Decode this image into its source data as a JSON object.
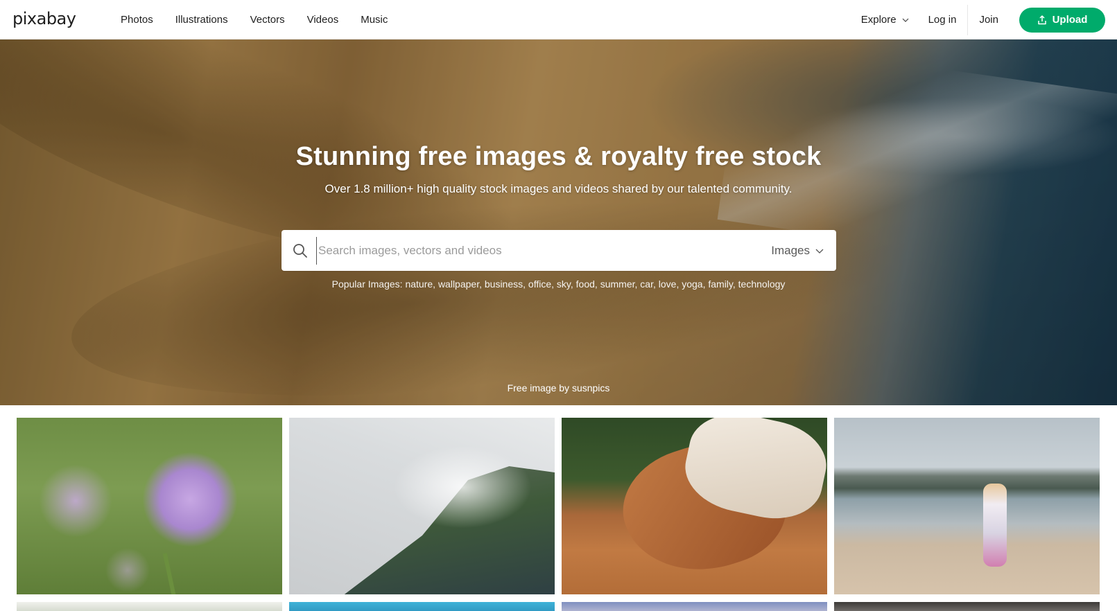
{
  "header": {
    "logo_text": "pixabay",
    "nav": [
      "Photos",
      "Illustrations",
      "Vectors",
      "Videos",
      "Music"
    ],
    "explore_label": "Explore",
    "login_label": "Log in",
    "join_label": "Join",
    "upload_label": "Upload",
    "accent_color": "#00ab6b"
  },
  "hero": {
    "title": "Stunning free images & royalty free stock",
    "subtitle": "Over 1.8 million+ high quality stock images and videos shared by our talented community.",
    "search": {
      "placeholder": "Search images, vectors and videos",
      "value": "",
      "type_selected": "Images"
    },
    "popular_label": "Popular Images:",
    "popular_tags": [
      "nature",
      "wallpaper",
      "business",
      "office",
      "sky",
      "food",
      "summer",
      "car",
      "love",
      "yoga",
      "family",
      "technology"
    ],
    "credit": "Free image by susnpics"
  },
  "icons": {
    "search": "search-icon",
    "chevron": "chevron-down-icon",
    "upload": "upload-icon"
  }
}
